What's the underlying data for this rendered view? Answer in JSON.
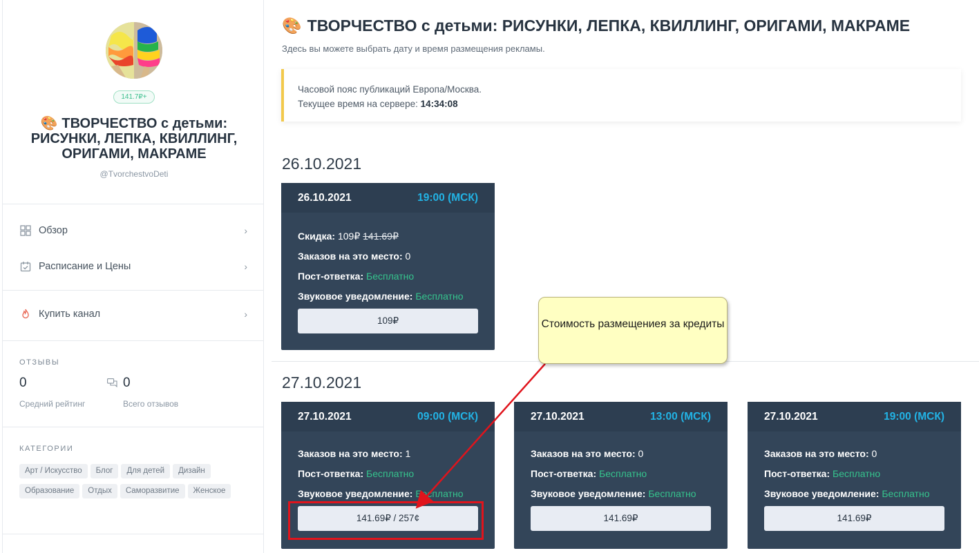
{
  "sidebar": {
    "subscribers": "141.7₽+",
    "channel_title": "ТВОРЧЕСТВО с детьми: РИСУНКИ, ЛЕПКА, КВИЛЛИНГ, ОРИГАМИ, МАКРАМЕ",
    "channel_handle": "@TvorchestvoDeti",
    "nav": [
      {
        "label": "Обзор",
        "icon": "grid-icon"
      },
      {
        "label": "Расписание и Цены",
        "icon": "calendar-check-icon"
      },
      {
        "label": "Купить канал",
        "icon": "fire-icon"
      }
    ],
    "reviews": {
      "heading": "ОТЗЫВЫ",
      "rating_value": "0",
      "rating_caption": "Средний рейтинг",
      "count_value": "0",
      "count_caption": "Всего отзывов"
    },
    "categories": {
      "heading": "КАТЕГОРИИ",
      "tags": [
        "Арт / Искусство",
        "Блог",
        "Для детей",
        "Дизайн",
        "Образование",
        "Отдых",
        "Саморазвитие",
        "Женское"
      ]
    }
  },
  "main": {
    "title": "ТВОРЧЕСТВО с детьми: РИСУНКИ, ЛЕПКА, КВИЛЛИНГ, ОРИГАМИ, МАКРАМЕ",
    "subtitle": "Здесь вы можете выбрать дату и время размещения рекламы.",
    "timezone_text": "Часовой пояс публикаций Европа/Москва.",
    "server_time_label": "Текущее время на сервере:",
    "server_time_value": "14:34:08",
    "days": [
      {
        "date": "26.10.2021",
        "slots": [
          {
            "date": "26.10.2021",
            "time": "19:00 (МСК)",
            "discount_label": "Скидка:",
            "discount_new": "109₽",
            "discount_old": "141.69₽",
            "orders_label": "Заказов на это место:",
            "orders": "0",
            "post_reply_label": "Пост-ответка:",
            "post_reply": "Бесплатно",
            "sound_label": "Звуковое уведомление:",
            "sound": "Бесплатно",
            "price": "109₽"
          }
        ]
      },
      {
        "date": "27.10.2021",
        "slots": [
          {
            "date": "27.10.2021",
            "time": "09:00 (МСК)",
            "orders_label": "Заказов на это место:",
            "orders": "1",
            "post_reply_label": "Пост-ответка:",
            "post_reply": "Бесплатно",
            "sound_label": "Звуковое уведомление:",
            "sound": "Бесплатно",
            "price": "141.69₽ / 257¢"
          },
          {
            "date": "27.10.2021",
            "time": "13:00 (МСК)",
            "orders_label": "Заказов на это место:",
            "orders": "0",
            "post_reply_label": "Пост-ответка:",
            "post_reply": "Бесплатно",
            "sound_label": "Звуковое уведомление:",
            "sound": "Бесплатно",
            "price": "141.69₽"
          },
          {
            "date": "27.10.2021",
            "time": "19:00 (МСК)",
            "orders_label": "Заказов на это место:",
            "orders": "0",
            "post_reply_label": "Пост-ответка:",
            "post_reply": "Бесплатно",
            "sound_label": "Звуковое уведомление:",
            "sound": "Бесплатно",
            "price": "141.69₽"
          }
        ]
      }
    ]
  },
  "annotation": {
    "callout_text": "Стоимость размещениея за кредиты",
    "color": "#e0141c"
  },
  "colors": {
    "card_bg": "#334559",
    "accent_time": "#22b3e5",
    "free_green": "#35c48d",
    "notice_border": "#f2c94c"
  }
}
